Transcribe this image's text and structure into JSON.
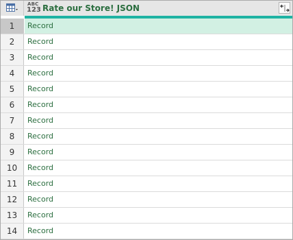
{
  "header": {
    "type_icon_top": "ABC",
    "type_icon_bottom": "123",
    "column_title": "Rate our Store! JSON",
    "table_icon": "table-menu-icon",
    "expand_icon": "expand-columns-icon"
  },
  "colors": {
    "header_bg": "#e6e6e6",
    "accent_bar": "#1fb3a3",
    "selected_row": "#d2f0e3",
    "record_text": "#2b6e3f"
  },
  "rows": [
    {
      "num": "1",
      "value": "Record"
    },
    {
      "num": "2",
      "value": "Record"
    },
    {
      "num": "3",
      "value": "Record"
    },
    {
      "num": "4",
      "value": "Record"
    },
    {
      "num": "5",
      "value": "Record"
    },
    {
      "num": "6",
      "value": "Record"
    },
    {
      "num": "7",
      "value": "Record"
    },
    {
      "num": "8",
      "value": "Record"
    },
    {
      "num": "9",
      "value": "Record"
    },
    {
      "num": "10",
      "value": "Record"
    },
    {
      "num": "11",
      "value": "Record"
    },
    {
      "num": "12",
      "value": "Record"
    },
    {
      "num": "13",
      "value": "Record"
    },
    {
      "num": "14",
      "value": "Record"
    }
  ]
}
